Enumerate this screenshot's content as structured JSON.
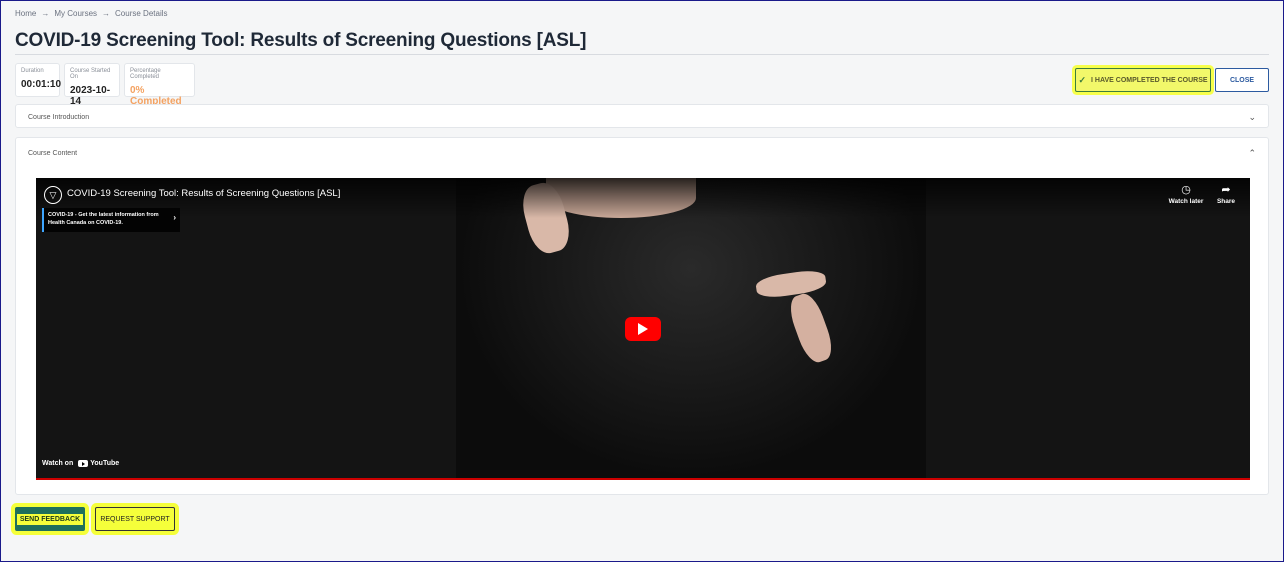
{
  "breadcrumb": {
    "items": [
      "Home",
      "My Courses",
      "Course Details"
    ],
    "separator": "→"
  },
  "page": {
    "title": "COVID-19 Screening Tool: Results of Screening Questions [ASL]"
  },
  "stats": {
    "duration": {
      "label": "Duration",
      "value": "00:01:10"
    },
    "started": {
      "label": "Course Started On",
      "value": "2023-10-14"
    },
    "completed": {
      "label": "Percentage Completed",
      "value": "0% Completed"
    }
  },
  "actions": {
    "complete_label": "I HAVE COMPLETED THE COURSE",
    "close_label": "CLOSE"
  },
  "sections": {
    "intro": {
      "label": "Course Introduction",
      "expanded": false
    },
    "content": {
      "label": "Course Content",
      "expanded": true
    }
  },
  "video": {
    "title": "COVID-19 Screening Tool: Results of Screening Questions [ASL]",
    "watch_later": "Watch later",
    "share": "Share",
    "info_card": "COVID-19 - Get the latest information from Health Canada on COVID-19.",
    "watch_on": "Watch on",
    "platform": "YouTube"
  },
  "footer": {
    "feedback_label": "SEND FEEDBACK",
    "support_label": "REQUEST SUPPORT"
  },
  "colors": {
    "highlight": "#f5ff3a",
    "accent_blue": "#2c5aa0",
    "progress_orange": "#f4a261",
    "youtube_red": "#ff0000"
  }
}
